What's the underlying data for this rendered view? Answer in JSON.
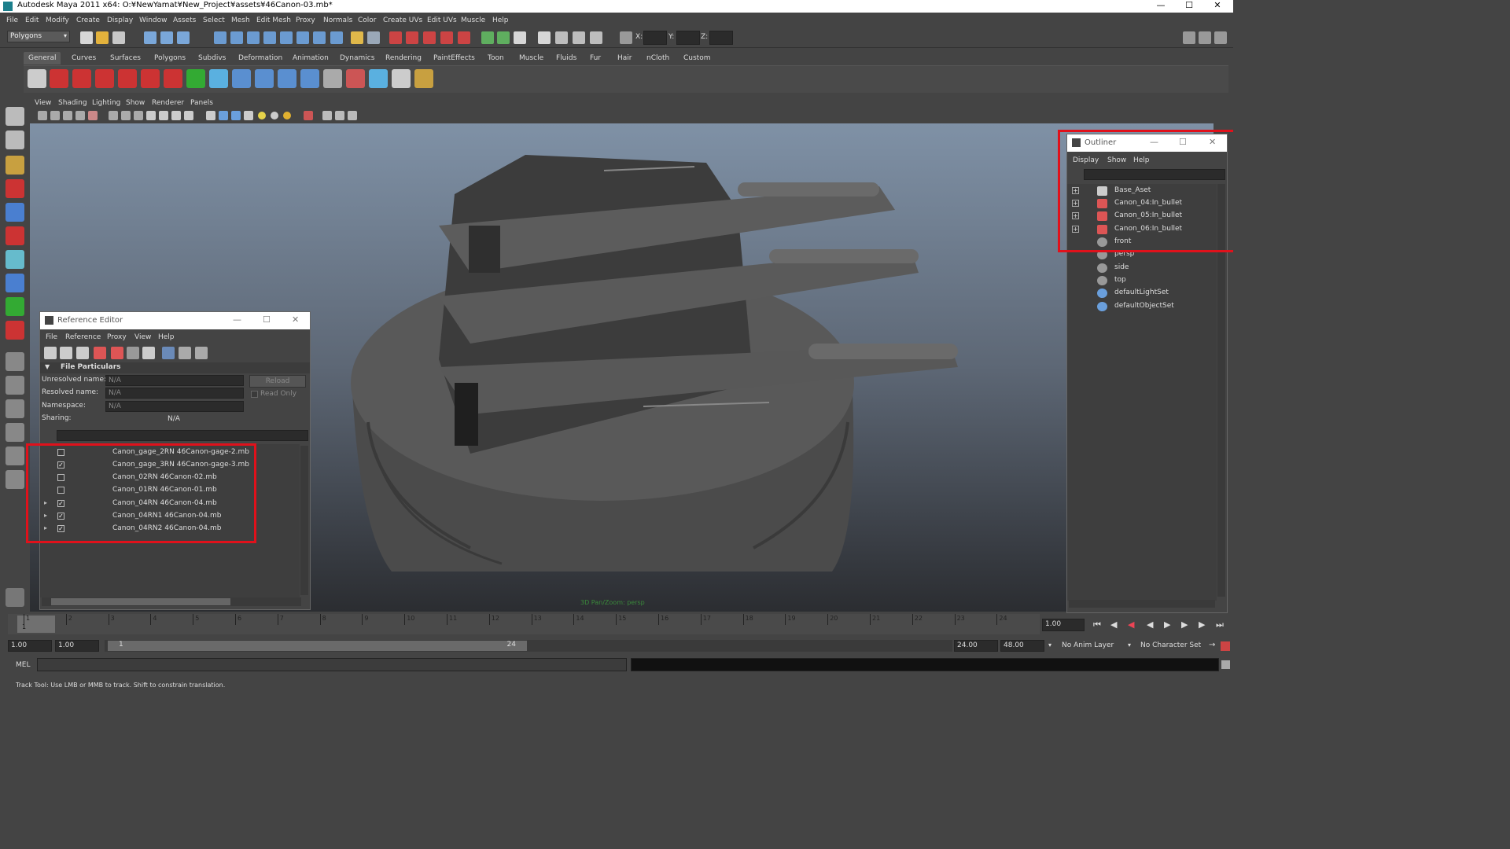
{
  "window": {
    "title": "Autodesk Maya 2011 x64: O:¥NewYamat¥New_Project¥assets¥46Canon-03.mb*"
  },
  "menubar": [
    "File",
    "Edit",
    "Modify",
    "Create",
    "Display",
    "Window",
    "Assets",
    "Select",
    "Mesh",
    "Edit Mesh",
    "Proxy",
    "Normals",
    "Color",
    "Create UVs",
    "Edit UVs",
    "Muscle",
    "Help"
  ],
  "status_line": {
    "mode_select": "Polygons",
    "x_label": "X:",
    "y_label": "Y:",
    "z_label": "Z:"
  },
  "shelf_tabs": [
    "General",
    "Curves",
    "Surfaces",
    "Polygons",
    "Subdivs",
    "Deformation",
    "Animation",
    "Dynamics",
    "Rendering",
    "PaintEffects",
    "Toon",
    "Muscle",
    "Fluids",
    "Fur",
    "Hair",
    "nCloth",
    "Custom"
  ],
  "shelf_active_tab": "General",
  "panel_menu": [
    "View",
    "Shading",
    "Lighting",
    "Show",
    "Renderer",
    "Panels"
  ],
  "viewport": {
    "camera_label": "3D Pan/Zoom: persp"
  },
  "reference_editor": {
    "title": "Reference Editor",
    "menu": [
      "File",
      "Reference",
      "Proxy",
      "View",
      "Help"
    ],
    "section": "File Particulars",
    "unresolved_label": "Unresolved name:",
    "unresolved_value": "N/A",
    "resolved_label": "Resolved name:",
    "resolved_value": "N/A",
    "namespace_label": "Namespace:",
    "namespace_value": "N/A",
    "sharing_label": "Sharing:",
    "sharing_value": "N/A",
    "reload_label": "Reload",
    "readonly_label": "Read Only",
    "references": [
      {
        "name": "Canon_gage_2RN 46Canon-gage-2.mb",
        "checked": false,
        "expandable": false
      },
      {
        "name": "Canon_gage_3RN 46Canon-gage-3.mb",
        "checked": true,
        "expandable": false
      },
      {
        "name": "Canon_02RN 46Canon-02.mb",
        "checked": false,
        "expandable": false
      },
      {
        "name": "Canon_01RN 46Canon-01.mb",
        "checked": false,
        "expandable": false
      },
      {
        "name": "Canon_04RN 46Canon-04.mb",
        "checked": true,
        "expandable": true
      },
      {
        "name": "Canon_04RN1 46Canon-04.mb",
        "checked": true,
        "expandable": true
      },
      {
        "name": "Canon_04RN2 46Canon-04.mb",
        "checked": true,
        "expandable": true
      }
    ]
  },
  "outliner": {
    "title": "Outliner",
    "menu": [
      "Display",
      "Show",
      "Help"
    ],
    "items": [
      {
        "name": "Base_Aset",
        "expandable": true,
        "icon": "group-icon"
      },
      {
        "name": "Canon_04:In_bullet",
        "expandable": true,
        "icon": "reference-node-icon"
      },
      {
        "name": "Canon_05:In_bullet",
        "expandable": true,
        "icon": "reference-node-icon"
      },
      {
        "name": "Canon_06:In_bullet",
        "expandable": true,
        "icon": "reference-node-icon"
      },
      {
        "name": "front",
        "expandable": false,
        "icon": "camera-icon"
      },
      {
        "name": "persp",
        "expandable": false,
        "icon": "camera-icon"
      },
      {
        "name": "side",
        "expandable": false,
        "icon": "camera-icon"
      },
      {
        "name": "top",
        "expandable": false,
        "icon": "camera-icon"
      },
      {
        "name": "defaultLightSet",
        "expandable": false,
        "icon": "set-icon"
      },
      {
        "name": "defaultObjectSet",
        "expandable": false,
        "icon": "set-icon"
      }
    ]
  },
  "timeline": {
    "frames": [
      "1",
      "2",
      "3",
      "4",
      "5",
      "6",
      "7",
      "8",
      "9",
      "10",
      "11",
      "12",
      "13",
      "14",
      "15",
      "16",
      "17",
      "18",
      "19",
      "20",
      "21",
      "22",
      "23",
      "24"
    ],
    "current_frame_field": "1.00",
    "current_frame_marker": "1"
  },
  "range": {
    "start": "1.00",
    "start_playback": "1.00",
    "slider_start": "1",
    "slider_end": "24",
    "end_playback": "24.00",
    "end": "48.00",
    "anim_layer": "No Anim Layer",
    "character_set": "No Character Set"
  },
  "command_line": {
    "lang": "MEL"
  },
  "help_line": "Track Tool: Use LMB or MMB to track. Shift to constrain translation.",
  "colors": {
    "highlight_box": "#e0111b",
    "ui_bg": "#444444"
  }
}
